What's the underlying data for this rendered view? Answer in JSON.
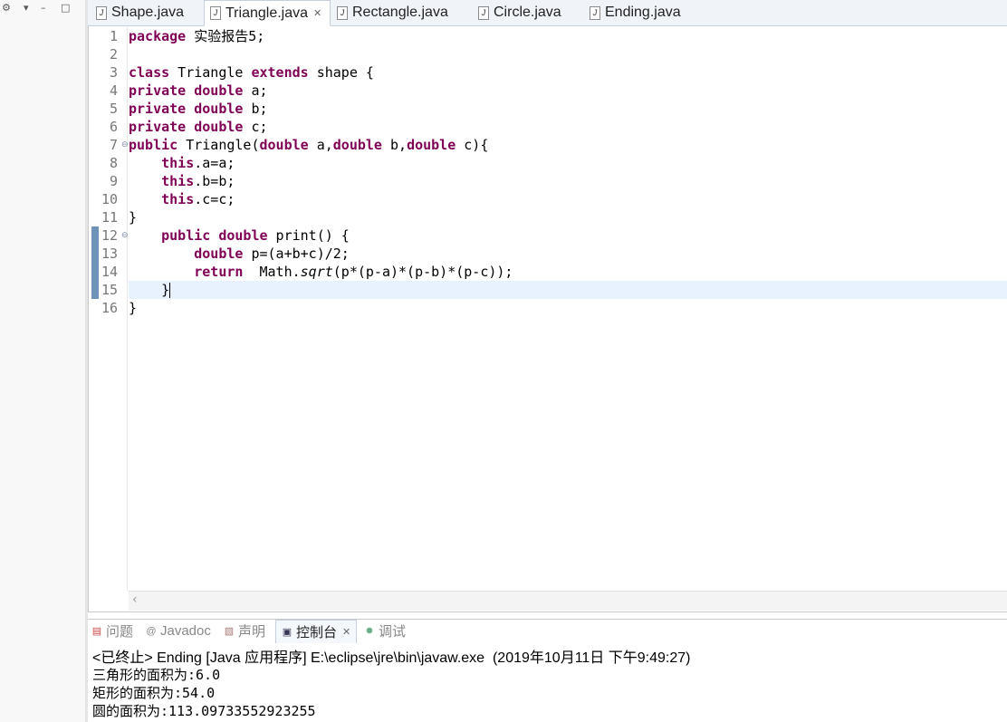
{
  "left_strip": {
    "controls": [
      "▾",
      "–",
      "□"
    ]
  },
  "editor_tabs": [
    {
      "label": "Shape.java",
      "active": false
    },
    {
      "label": "Triangle.java",
      "active": true,
      "close": "✕"
    },
    {
      "label": "Rectangle.java",
      "active": false
    },
    {
      "label": "Circle.java",
      "active": false
    },
    {
      "label": "Ending.java",
      "active": false
    }
  ],
  "editor": {
    "line_numbers": [
      "1",
      "2",
      "3",
      "4",
      "5",
      "6",
      "7",
      "8",
      "9",
      "10",
      "11",
      "12",
      "13",
      "14",
      "15",
      "16"
    ],
    "current_line": 15,
    "lines": [
      [
        {
          "k": true,
          "t": "package"
        },
        {
          "t": " 实验报告5;"
        }
      ],
      [],
      [
        {
          "k": true,
          "t": "class"
        },
        {
          "t": " Triangle "
        },
        {
          "k": true,
          "t": "extends"
        },
        {
          "t": " shape {"
        }
      ],
      [
        {
          "k": true,
          "t": "private"
        },
        {
          "t": " "
        },
        {
          "k": true,
          "t": "double"
        },
        {
          "t": " a;"
        }
      ],
      [
        {
          "k": true,
          "t": "private"
        },
        {
          "t": " "
        },
        {
          "k": true,
          "t": "double"
        },
        {
          "t": " b;"
        }
      ],
      [
        {
          "k": true,
          "t": "private"
        },
        {
          "t": " "
        },
        {
          "k": true,
          "t": "double"
        },
        {
          "t": " c;"
        }
      ],
      [
        {
          "k": true,
          "t": "public"
        },
        {
          "t": " Triangle("
        },
        {
          "k": true,
          "t": "double"
        },
        {
          "t": " a,"
        },
        {
          "k": true,
          "t": "double"
        },
        {
          "t": " b,"
        },
        {
          "k": true,
          "t": "double"
        },
        {
          "t": " c){"
        }
      ],
      [
        {
          "t": "    "
        },
        {
          "k": true,
          "t": "this"
        },
        {
          "t": ".a=a;"
        }
      ],
      [
        {
          "t": "    "
        },
        {
          "k": true,
          "t": "this"
        },
        {
          "t": ".b=b;"
        }
      ],
      [
        {
          "t": "    "
        },
        {
          "k": true,
          "t": "this"
        },
        {
          "t": ".c=c;"
        }
      ],
      [
        {
          "t": "}"
        }
      ],
      [
        {
          "t": "    "
        },
        {
          "k": true,
          "t": "public"
        },
        {
          "t": " "
        },
        {
          "k": true,
          "t": "double"
        },
        {
          "t": " print() {"
        }
      ],
      [
        {
          "t": "        "
        },
        {
          "k": true,
          "t": "double"
        },
        {
          "t": " p=(a+b+c)/2;"
        }
      ],
      [
        {
          "t": "        "
        },
        {
          "k": true,
          "t": "return"
        },
        {
          "t": "  Math."
        },
        {
          "i": true,
          "t": "sqrt"
        },
        {
          "t": "(p*(p-a)*(p-b)*(p-c));"
        }
      ],
      [
        {
          "t": "    }"
        }
      ],
      [
        {
          "t": "}"
        }
      ]
    ],
    "fold_markers": [
      "7",
      "12"
    ]
  },
  "panel_tabs": [
    {
      "label": "问题",
      "icon": "problems-icon",
      "glyph": "▤",
      "active": false
    },
    {
      "label": "Javadoc",
      "icon": "javadoc-icon",
      "glyph": "@",
      "active": false
    },
    {
      "label": "声明",
      "icon": "declaration-icon",
      "glyph": "▧",
      "active": false
    },
    {
      "label": "控制台",
      "icon": "console-icon",
      "glyph": "▣",
      "active": true,
      "close": "✕"
    },
    {
      "label": "调试",
      "icon": "debug-icon",
      "glyph": "✹",
      "active": false
    }
  ],
  "console": {
    "terminated": "<已终止> Ending [Java 应用程序] E:\\eclipse\\jre\\bin\\javaw.exe  (2019年10月11日 下午9:49:27)",
    "output": [
      "三角形的面积为:6.0",
      "矩形的面积为:54.0",
      "圆的面积为:113.09733552923255"
    ]
  }
}
